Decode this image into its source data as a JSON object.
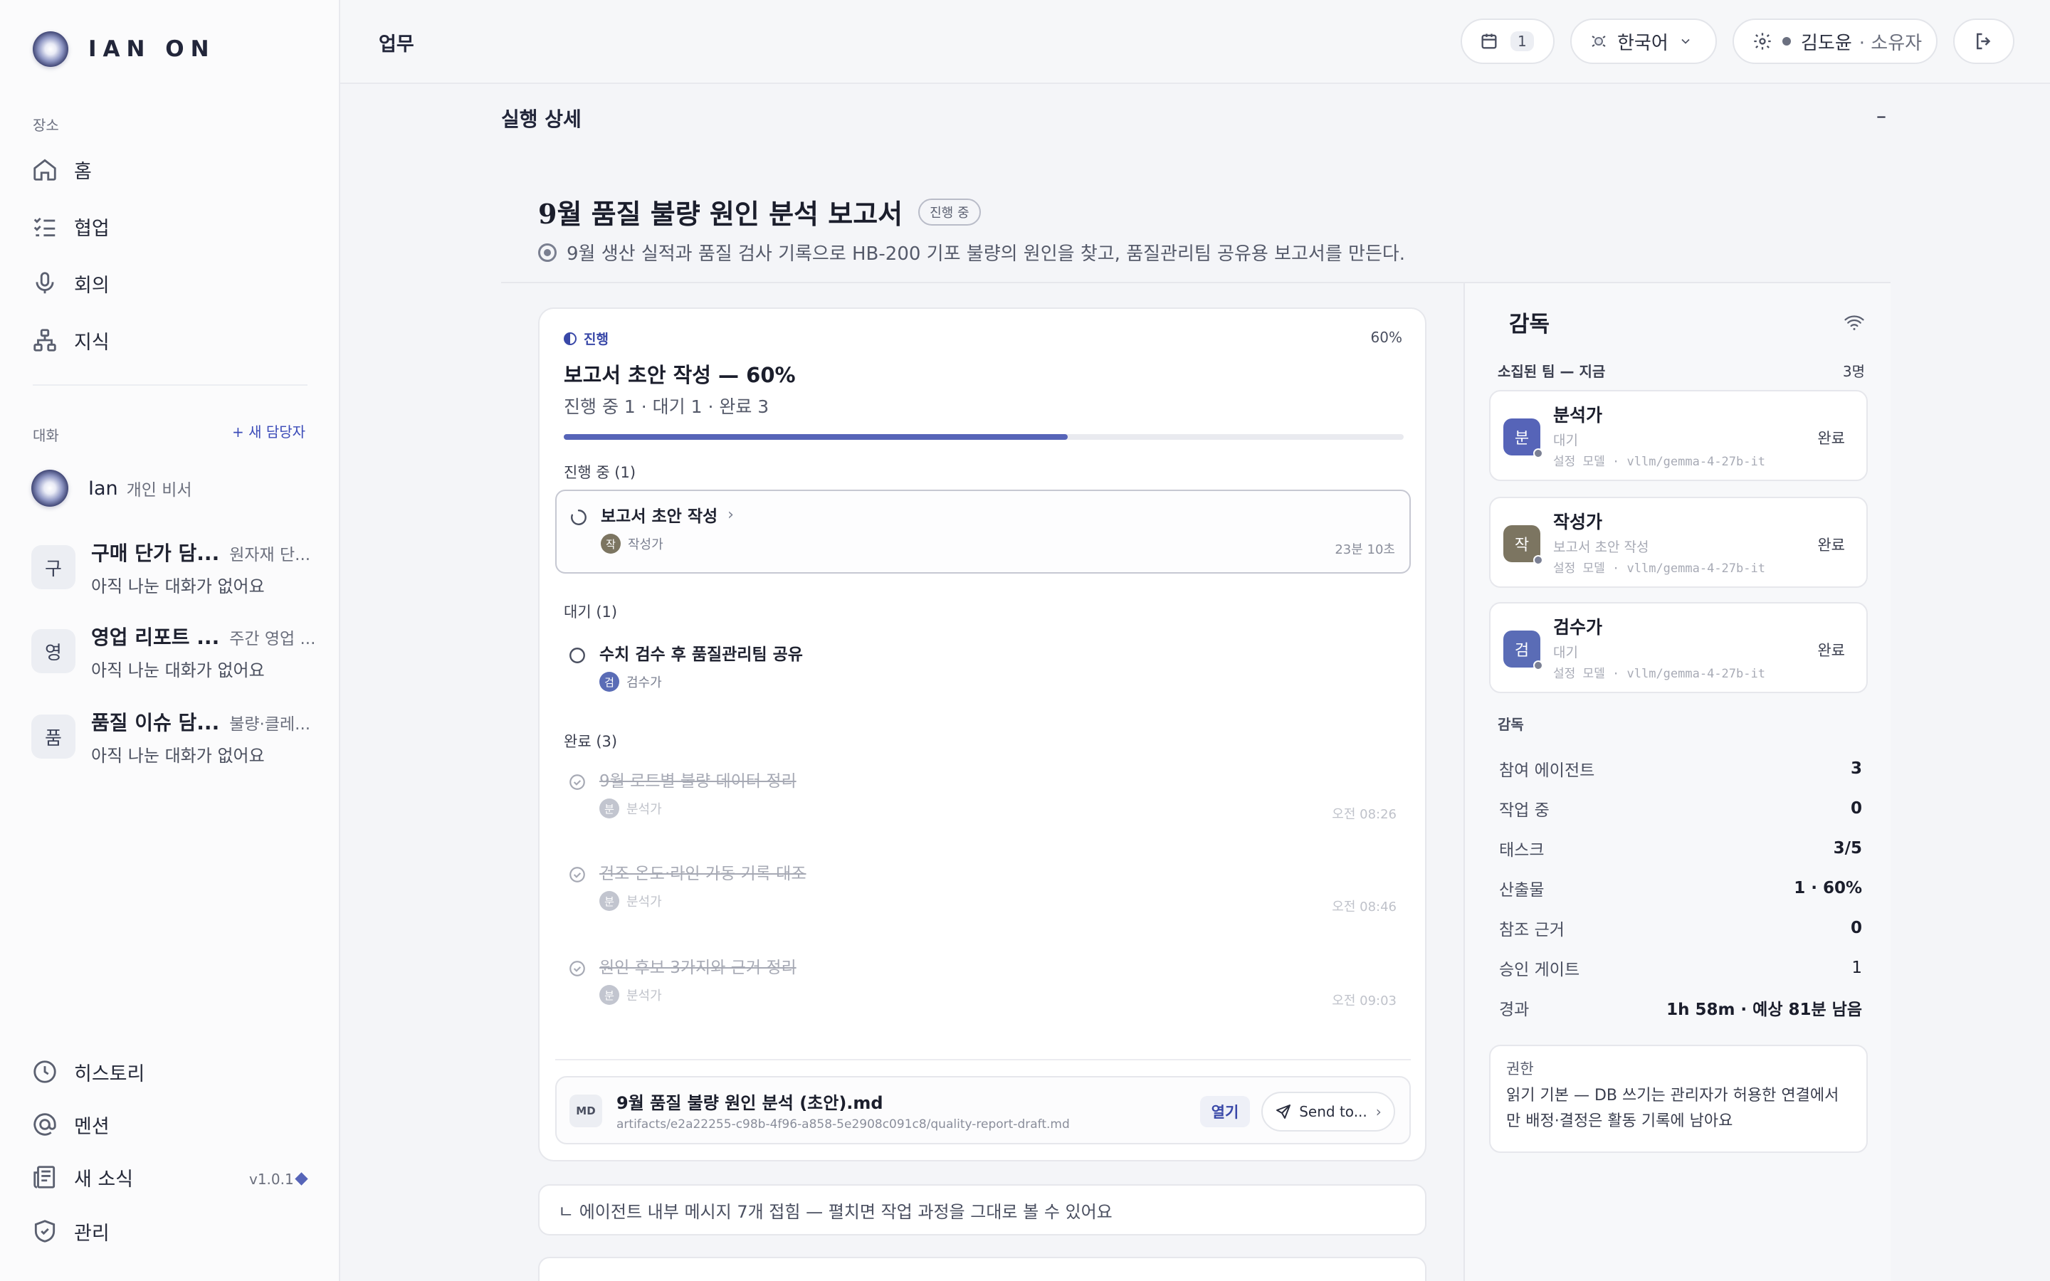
{
  "brand": {
    "name": "IAN ON"
  },
  "sidebar": {
    "places_label": "장소",
    "nav": [
      {
        "label": "홈",
        "icon": "home-icon"
      },
      {
        "label": "협업",
        "icon": "checklist-icon"
      },
      {
        "label": "회의",
        "icon": "microphone-icon"
      },
      {
        "label": "지식",
        "icon": "hierarchy-icon"
      }
    ],
    "chats_label": "대화",
    "new_agent_label": "+ 새 담당자",
    "ian": {
      "name": "Ian",
      "role": "개인 비서"
    },
    "chats": [
      {
        "avatar": "구",
        "title": "구매 단가 담...",
        "subtitle": "원자재 단...",
        "last": "아직 나눈 대화가 없어요"
      },
      {
        "avatar": "영",
        "title": "영업 리포트 ...",
        "subtitle": "주간 영업 ...",
        "last": "아직 나눈 대화가 없어요"
      },
      {
        "avatar": "품",
        "title": "품질 이슈 담...",
        "subtitle": "불량·클레...",
        "last": "아직 나눈 대화가 없어요"
      }
    ],
    "bottom_nav": [
      {
        "label": "히스토리",
        "icon": "clock-icon"
      },
      {
        "label": "멘션",
        "icon": "at-sign-icon"
      },
      {
        "label": "새 소식",
        "icon": "newspaper-icon"
      },
      {
        "label": "관리",
        "icon": "shield-icon"
      }
    ],
    "version": "v1.0.1"
  },
  "topbar": {
    "title": "업무",
    "calendar_count": "1",
    "language": "한국어",
    "user_name": "김도윤",
    "user_role": "· 소유자"
  },
  "detail": {
    "header": "실행 상세",
    "collapse": "–",
    "title": "9월 품질 불량 원인 분석 보고서",
    "status_chip": "진행 중",
    "description": "9월 생산 실적과 품질 검사 기록으로 HB-200 기포 불량의 원인을 찾고, 품질관리팀 공유용 보고서를 만든다."
  },
  "progress_card": {
    "tag": "진행",
    "percent_label": "60%",
    "progress": 0.6,
    "title": "보고서 초안 작성 — 60%",
    "summary": "진행 중 1 · 대기 1 · 완료 3",
    "in_progress_label": "진행 중 (1)",
    "waiting_label": "대기 (1)",
    "done_label": "완료 (3)",
    "in_progress": [
      {
        "title": "보고서 초안 작성",
        "chev": "›",
        "avatar": "작",
        "agent": "작성가",
        "time": "23분 10초"
      }
    ],
    "waiting": [
      {
        "title": "수치 검수 후 품질관리팀 공유",
        "avatar": "검",
        "agent": "검수가",
        "time": ""
      }
    ],
    "done": [
      {
        "title": "9월 로트별 불량 데이터 정리",
        "avatar": "분",
        "agent": "분석가",
        "time": "오전 08:26"
      },
      {
        "title": "건조 온도·라인 가동 기록 대조",
        "avatar": "분",
        "agent": "분석가",
        "time": "오전 08:46"
      },
      {
        "title": "원인 후보 3가지와 근거 정리",
        "avatar": "분",
        "agent": "분석가",
        "time": "오전 09:03"
      }
    ],
    "artifact": {
      "badge": "MD",
      "name": "9월 품질 불량 원인 분석 (초안).md",
      "path": "artifacts/e2a22255-c98b-4f96-a858-5e2908c091c8/quality-report-draft.md",
      "open_label": "열기",
      "send_label": "Send to..."
    }
  },
  "collapsed_messages": "ㄴ 에이전트 내부 메시지 7개 접힘 — 펼치면 작업 과정을 그대로 볼 수 있어요",
  "supervision": {
    "title": "감독",
    "team_label": "소집된 팀 — 지금",
    "team_count": "3명",
    "agents": [
      {
        "avatar": "분",
        "color": "#5664b8",
        "name": "분석가",
        "status": "대기",
        "model": "설정 모델 · vllm/gemma-4-27b-it",
        "state": "완료"
      },
      {
        "avatar": "작",
        "color": "#7c7561",
        "name": "작성가",
        "status": "보고서 초안 작성",
        "model": "설정 모델 · vllm/gemma-4-27b-it",
        "state": "완료"
      },
      {
        "avatar": "검",
        "color": "#5a6cb6",
        "name": "검수가",
        "status": "대기",
        "model": "설정 모델 · vllm/gemma-4-27b-it",
        "state": "완료"
      }
    ],
    "stats_label": "감독",
    "stats": [
      {
        "k": "참여 에이전트",
        "v": "3"
      },
      {
        "k": "작업 중",
        "v": "0"
      },
      {
        "k": "태스크",
        "v": "3/5"
      },
      {
        "k": "산출물",
        "v": "1 · 60%"
      },
      {
        "k": "참조 근거",
        "v": "0"
      },
      {
        "k": "승인 게이트",
        "v": "1"
      },
      {
        "k": "경과",
        "v": "1h 58m · 예상 81분 남음"
      }
    ],
    "permission": {
      "label": "권한",
      "text": "읽기 기본 — DB 쓰기는 관리자가 허용한 연결에서만 배정·결정은 활동 기록에 남아요"
    }
  },
  "colors": {
    "accent": "#5664b8",
    "accent_text": "#3948a8"
  }
}
